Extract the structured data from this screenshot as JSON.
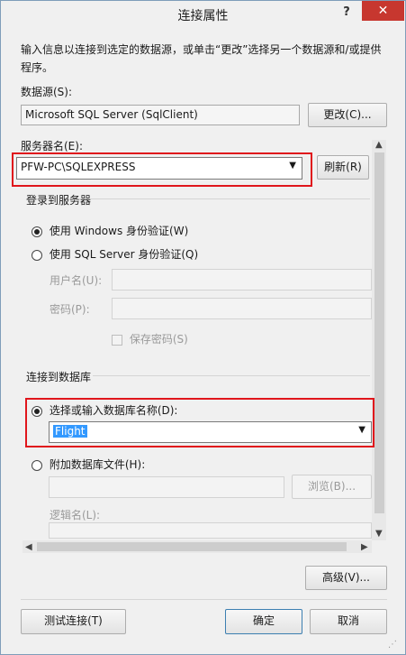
{
  "window": {
    "title": "连接属性",
    "help_label": "?",
    "close_label": "✕"
  },
  "description": "输入信息以连接到选定的数据源，或单击“更改”选择另一个数据源和/或提供程序。",
  "datasource": {
    "label": "数据源(S):",
    "value": "Microsoft SQL Server (SqlClient)",
    "change_button": "更改(C)..."
  },
  "server": {
    "label": "服务器名(E):",
    "value": "PFW-PC\\SQLEXPRESS",
    "refresh_button": "刷新(R)"
  },
  "login": {
    "group_title": "登录到服务器",
    "windows_auth": "使用 Windows 身份验证(W)",
    "sql_auth": "使用 SQL Server 身份验证(Q)",
    "username_label": "用户名(U):",
    "password_label": "密码(P):",
    "save_password": "保存密码(S)"
  },
  "database": {
    "group_title": "连接到数据库",
    "select_option": "选择或输入数据库名称(D):",
    "selected_db": "Flight",
    "attach_option": "附加数据库文件(H):",
    "browse_button": "浏览(B)...",
    "logical_name_label": "逻辑名(L):"
  },
  "footer": {
    "advanced_button": "高级(V)...",
    "test_button": "测试连接(T)",
    "ok_button": "确定",
    "cancel_button": "取消"
  },
  "colors": {
    "highlight_border": "#e0161c",
    "close_button": "#c7372f",
    "selection": "#3399ff"
  }
}
